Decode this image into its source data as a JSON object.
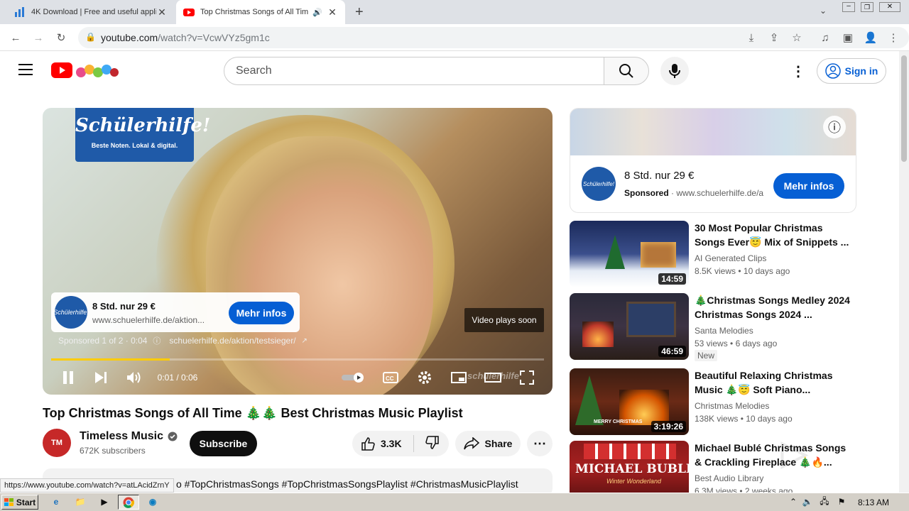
{
  "browser": {
    "tabs": [
      {
        "title": "4K Download | Free and useful applic"
      },
      {
        "title": "Top Christmas Songs of All Time"
      }
    ],
    "url_domain": "youtube.com",
    "url_path": "/watch?v=VcwVYz5gm1c"
  },
  "yt_header": {
    "search_placeholder": "Search",
    "sign_in": "Sign in"
  },
  "player": {
    "brand_name": "Schülerhilfe!",
    "brand_tagline": "Beste Noten. Lokal & digital.",
    "ad_title": "8 Std. nur 29 €",
    "ad_url": "www.schuelerhilfe.de/aktion...",
    "ad_cta": "Mehr infos",
    "sponsored_text": "Sponsored 1 of 2 · 0:04",
    "sponsored_link": "schuelerhilfe.de/aktion/testsieger/",
    "plays_soon": "Video plays soon",
    "time": "0:01 / 0:06",
    "progress": 0.24,
    "watermark": "schülerhilfe"
  },
  "side_ad": {
    "title": "8 Std. nur 29 €",
    "sponsored": "Sponsored",
    "url": "www.schuelerhilfe.de/a",
    "cta": "Mehr infos"
  },
  "recommendations": [
    {
      "title": "30 Most Popular Christmas Songs Ever😇 Mix of Snippets ...",
      "channel": "AI Generated Clips",
      "views": "8.5K views",
      "age": "10 days ago",
      "duration": "14:59",
      "badge": ""
    },
    {
      "title": "🎄Christmas Songs Medley 2024 Christmas Songs 2024 ...",
      "channel": "Santa Melodies",
      "views": "53 views",
      "age": "6 days ago",
      "duration": "46:59",
      "badge": "New"
    },
    {
      "title": "Beautiful Relaxing Christmas Music 🎄😇 Soft Piano...",
      "channel": "Christmas Melodies",
      "views": "138K views",
      "age": "10 days ago",
      "duration": "3:19:26",
      "badge": ""
    },
    {
      "title": "Michael Bublé Christmas Songs & Crackling Fireplace 🎄🔥...",
      "channel": "Best Audio Library",
      "views": "6.3M views",
      "age": "2 weeks ago",
      "duration": "",
      "badge": ""
    }
  ],
  "thumb_text": {
    "michael": "MICHAEL BUBLÉ",
    "michael_sub": "Winter Wonderland",
    "merry": "MERRY CHRISTMAS"
  },
  "video": {
    "title": "Top Christmas Songs of All Time 🎄🎄 Best Christmas Music Playlist",
    "channel": "Timeless Music",
    "subscribers": "672K subscribers",
    "avatar_text": "TM",
    "subscribe": "Subscribe",
    "likes": "3.3K",
    "share": "Share",
    "description": "o #TopChristmasSongs #TopChristmasSongsPlaylist #ChristmasMusicPlaylist"
  },
  "status_url": "https://www.youtube.com/watch?v=atLAcidZrnY",
  "taskbar": {
    "start": "Start",
    "clock": "8:13 AM"
  },
  "colors": {
    "yt_red": "#ff0000",
    "link_blue": "#065fd4",
    "progress_yellow": "#ffcc00"
  }
}
